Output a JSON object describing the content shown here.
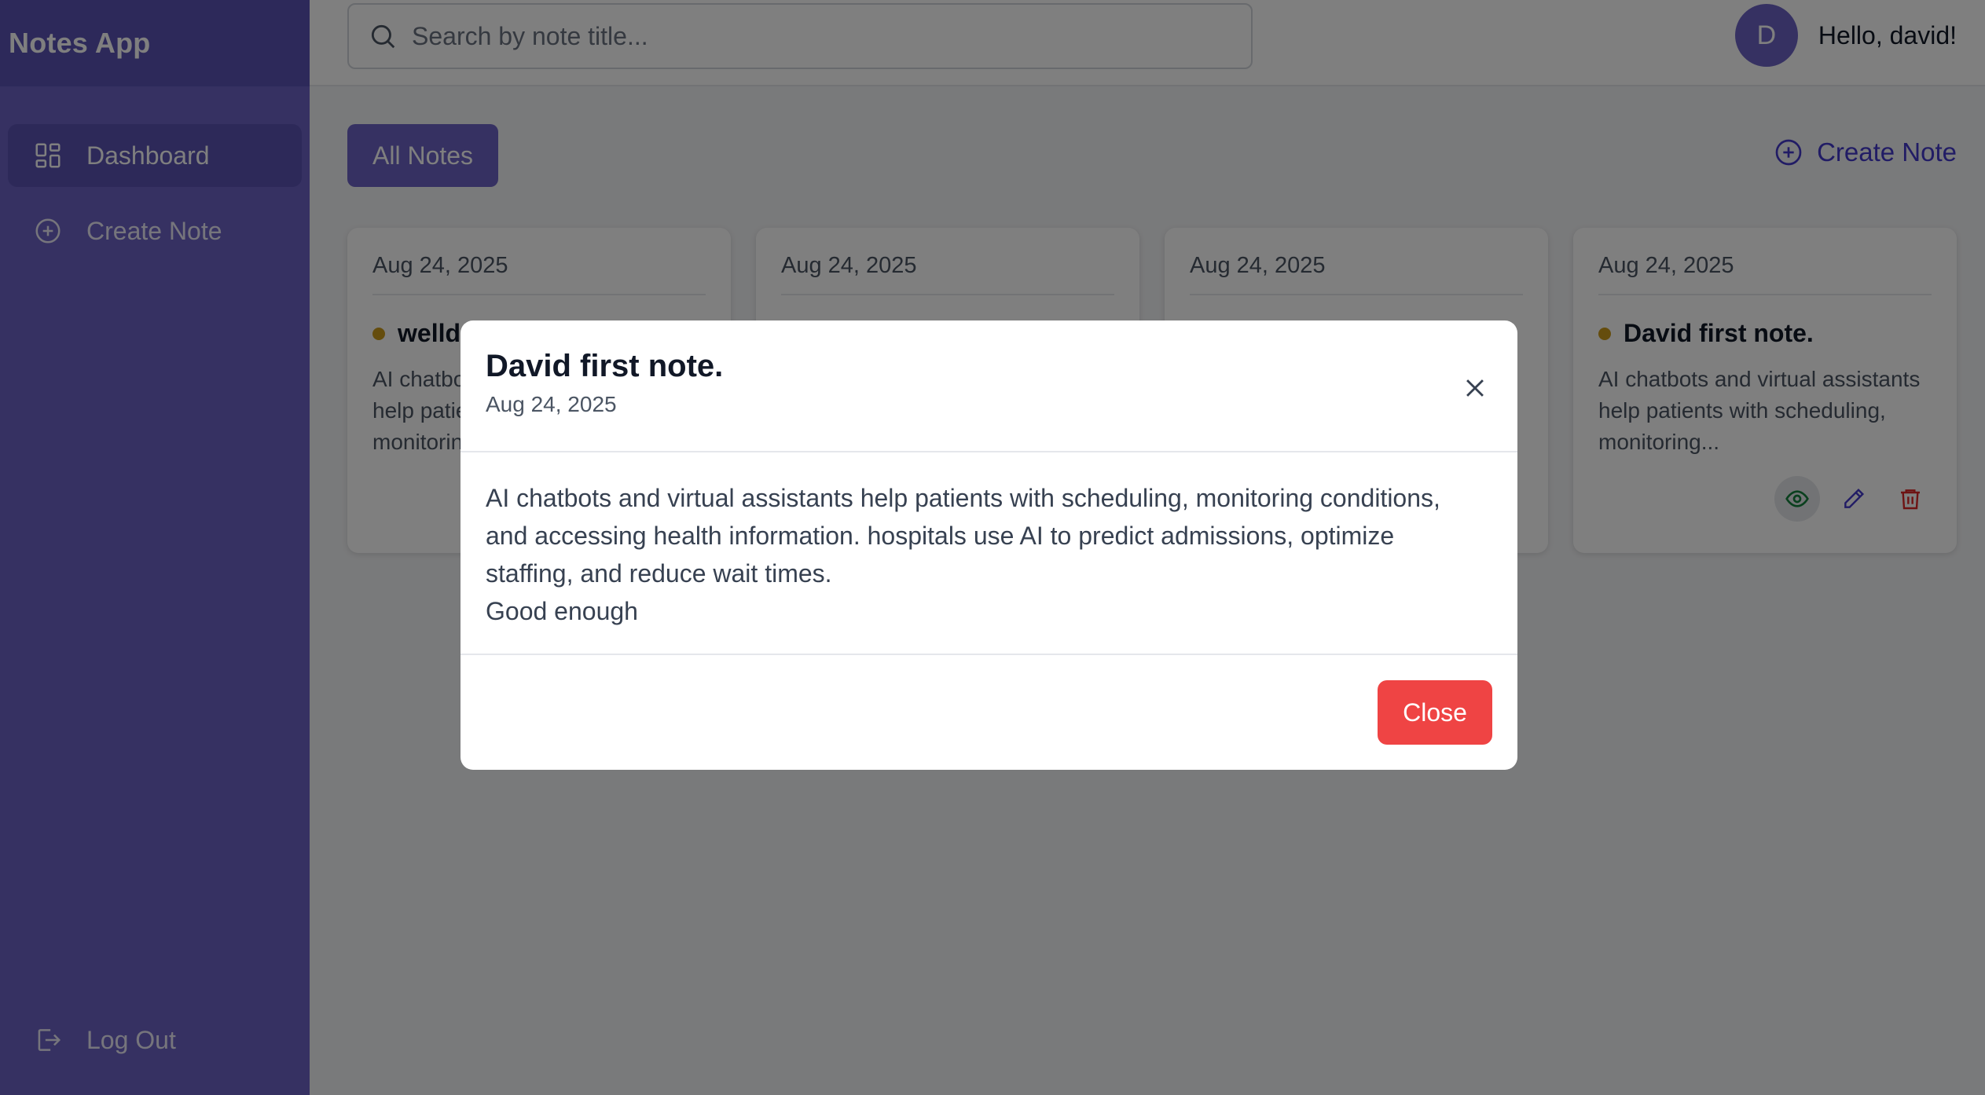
{
  "app": {
    "title": "Notes App"
  },
  "sidebar": {
    "items": [
      {
        "label": "Dashboard",
        "icon": "dashboard-grid-icon",
        "active": true
      },
      {
        "label": "Create Note",
        "icon": "plus-circle-icon",
        "active": false
      }
    ],
    "logout_label": "Log Out"
  },
  "search": {
    "placeholder": "Search by note title..."
  },
  "user": {
    "avatar_initial": "D",
    "greeting": "Hello, david!"
  },
  "main": {
    "tab_label": "All Notes",
    "create_label": "Create Note"
  },
  "notes": [
    {
      "date": "Aug 24, 2025",
      "title": "welld",
      "body": "AI chatbots and virtual assistants help patients with scheduling, monitoring..."
    },
    {
      "date": "Aug 24, 2025",
      "title": "",
      "body": ""
    },
    {
      "date": "Aug 24, 2025",
      "title": "",
      "body": ""
    },
    {
      "date": "Aug 24, 2025",
      "title": "David first note.",
      "body": "AI chatbots and virtual assistants help patients with scheduling, monitoring..."
    }
  ],
  "modal": {
    "title": "David first note.",
    "date": "Aug 24, 2025",
    "body_line1": "AI chatbots and virtual assistants help patients with scheduling, monitoring conditions,",
    "body_line2": "and accessing health information. hospitals use AI to predict admissions, optimize",
    "body_line3": "staffing, and reduce wait times.",
    "body_line4": "Good enough",
    "close_label": "Close"
  },
  "colors": {
    "sidebar": "#6c63c4",
    "accent": "#4338ca",
    "danger": "#ef4444",
    "dot": "#ca9a1a"
  }
}
